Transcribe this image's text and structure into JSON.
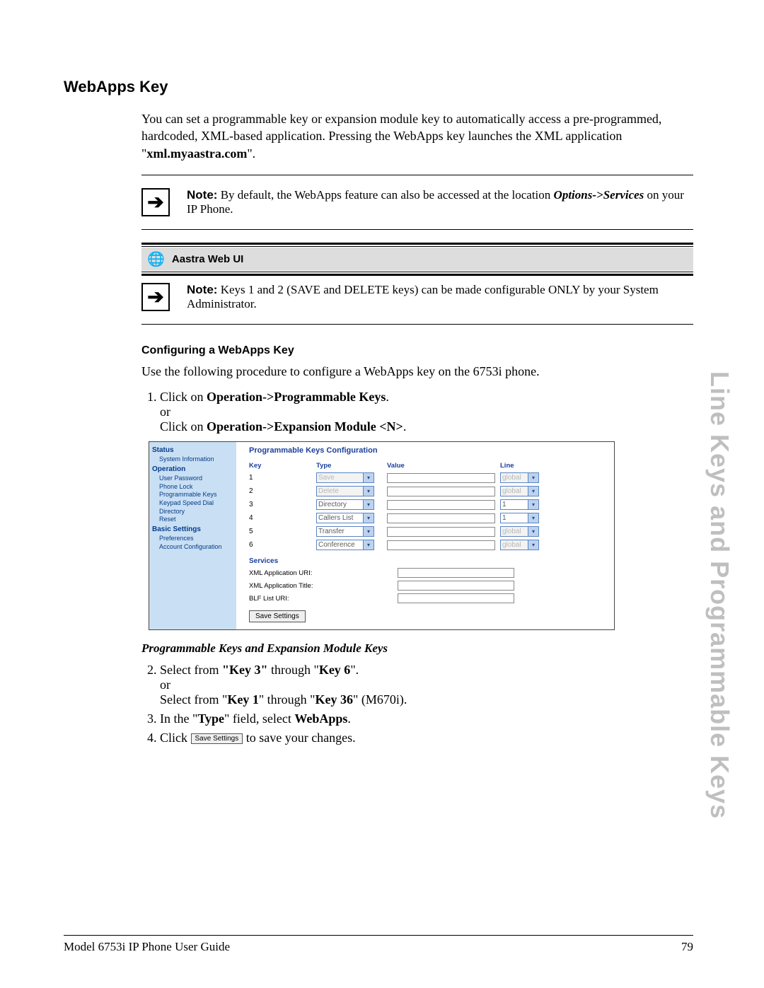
{
  "heading": "WebApps Key",
  "intro_parts": {
    "p1a": "You can set a programmable key or expansion module key to automatically access a pre-programmed, hardcoded, XML-based application. Pressing the WebApps key launches the XML application \"",
    "p1b": "xml.myaastra.com",
    "p1c": "\"."
  },
  "note1": {
    "bold": "Note:",
    "t1": " By default, the WebApps feature can also be accessed at the location ",
    "italic": "Options->Services",
    "t2": " on your IP Phone."
  },
  "aastra_bar": "Aastra Web UI",
  "note2": {
    "bold": "Note:",
    "t1": " Keys 1 and 2 (SAVE and DELETE keys) can be made configurable ONLY by your System Administrator."
  },
  "subhead": "Configuring a WebApps Key",
  "para": "Use the following procedure to configure a WebApps key on the 6753i phone.",
  "steps": {
    "s1a": "Click on ",
    "s1b": "Operation->Programmable Keys",
    "s1c": ".",
    "or": "or",
    "s1d": "Click on ",
    "s1e": "Operation->Expansion Module <N>",
    "s1f": "."
  },
  "subitalic": "Programmable Keys and Expansion Module Keys",
  "step2": {
    "a": "Select from ",
    "b": "\"Key 3\"",
    "c": " through \"",
    "d": "Key 6",
    "e": "\".",
    "or": "or",
    "f": "Select from \"",
    "g": "Key 1",
    "h": "\" through \"",
    "i": "Key 36",
    "j": "\" (M670i)."
  },
  "step3": {
    "a": "In the \"",
    "b": "Type",
    "c": "\" field, select ",
    "d": "WebApps",
    "e": "."
  },
  "step4": {
    "a": "Click ",
    "btn": "Save Settings",
    "b": " to save your changes."
  },
  "webui": {
    "title": "Programmable Keys Configuration",
    "nav": {
      "h1": "Status",
      "i1": "System Information",
      "h2": "Operation",
      "i2": "User Password",
      "i3": "Phone Lock",
      "i4": "Programmable Keys",
      "i5": "Keypad Speed Dial",
      "i6": "Directory",
      "i7": "Reset",
      "h3": "Basic Settings",
      "i8": "Preferences",
      "i9": "Account Configuration"
    },
    "cols": {
      "key": "Key",
      "type": "Type",
      "value": "Value",
      "line": "Line"
    },
    "rows": [
      {
        "key": "1",
        "type": "Save",
        "type_disabled": true,
        "line": "global",
        "line_disabled": true
      },
      {
        "key": "2",
        "type": "Delete",
        "type_disabled": true,
        "line": "global",
        "line_disabled": true
      },
      {
        "key": "3",
        "type": "Directory",
        "type_disabled": false,
        "line": "1",
        "line_disabled": false
      },
      {
        "key": "4",
        "type": "Callers List",
        "type_disabled": false,
        "line": "1",
        "line_disabled": false
      },
      {
        "key": "5",
        "type": "Transfer",
        "type_disabled": false,
        "line": "global",
        "line_disabled": true
      },
      {
        "key": "6",
        "type": "Conference",
        "type_disabled": false,
        "line": "global",
        "line_disabled": true
      }
    ],
    "services_hdr": "Services",
    "services": [
      "XML Application URI:",
      "XML Application Title:",
      "BLF List URI:"
    ],
    "save_btn": "Save Settings"
  },
  "side_text": "Line Keys and Programmable Keys",
  "footer": {
    "left": "Model 6753i IP Phone User Guide",
    "right": "79"
  }
}
